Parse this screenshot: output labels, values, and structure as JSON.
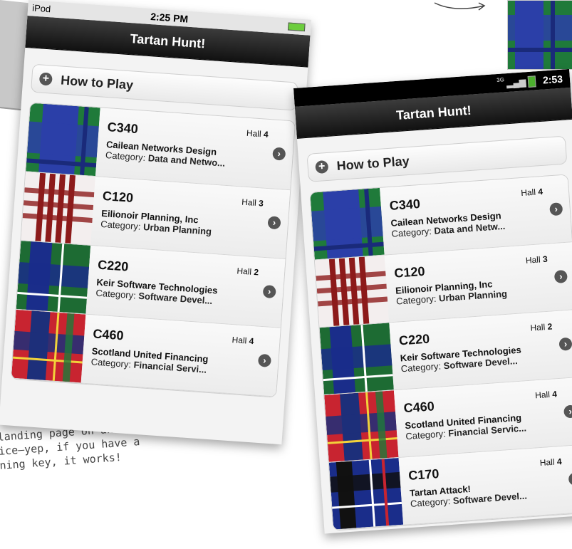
{
  "ios": {
    "status": {
      "carrier": "iPod",
      "time": "2:25 PM"
    },
    "header_title": "Tartan Hunt!",
    "howto_label": "How to Play",
    "items": [
      {
        "code": "C340",
        "hall_label": "Hall",
        "hall_num": "4",
        "company": "Cailean Networks Design",
        "cat_label": "Category:",
        "category": "Data and Netwo..."
      },
      {
        "code": "C120",
        "hall_label": "Hall",
        "hall_num": "3",
        "company": "Eilionoir Planning, Inc",
        "cat_label": "Category:",
        "category": "Urban Planning"
      },
      {
        "code": "C220",
        "hall_label": "Hall",
        "hall_num": "2",
        "company": "Keir Software Technologies",
        "cat_label": "Category:",
        "category": "Software Devel..."
      },
      {
        "code": "C460",
        "hall_label": "Hall",
        "hall_num": "4",
        "company": "Scotland United Financing",
        "cat_label": "Category:",
        "category": "Financial Servi..."
      }
    ]
  },
  "android": {
    "status": {
      "time": "2:53",
      "network": "3G"
    },
    "header_title": "Tartan Hunt!",
    "howto_label": "How to Play",
    "items": [
      {
        "code": "C340",
        "hall_label": "Hall",
        "hall_num": "4",
        "company": "Cailean Networks Design",
        "cat_label": "Category:",
        "category": "Data and Netw..."
      },
      {
        "code": "C120",
        "hall_label": "Hall",
        "hall_num": "3",
        "company": "Eilionoir Planning, Inc",
        "cat_label": "Category:",
        "category": "Urban Planning"
      },
      {
        "code": "C220",
        "hall_label": "Hall",
        "hall_num": "2",
        "company": "Keir Software Technologies",
        "cat_label": "Category:",
        "category": "Software Devel..."
      },
      {
        "code": "C460",
        "hall_label": "Hall",
        "hall_num": "4",
        "company": "Scotland United Financing",
        "cat_label": "Category:",
        "category": "Financial Servic..."
      },
      {
        "code": "C170",
        "hall_label": "Hall",
        "hall_num": "4",
        "company": "Tartan Attack!",
        "cat_label": "Category:",
        "category": "Software Devel..."
      }
    ]
  },
  "annotation": {
    "line1": "landing page on an iOS",
    "line2": "ice—yep, if you have a",
    "line3": "ning key, it works!"
  },
  "icons": {
    "plus": "+",
    "chevron": "›"
  },
  "colors": {
    "header_dark": "#111111",
    "accent_green": "#67b867"
  }
}
